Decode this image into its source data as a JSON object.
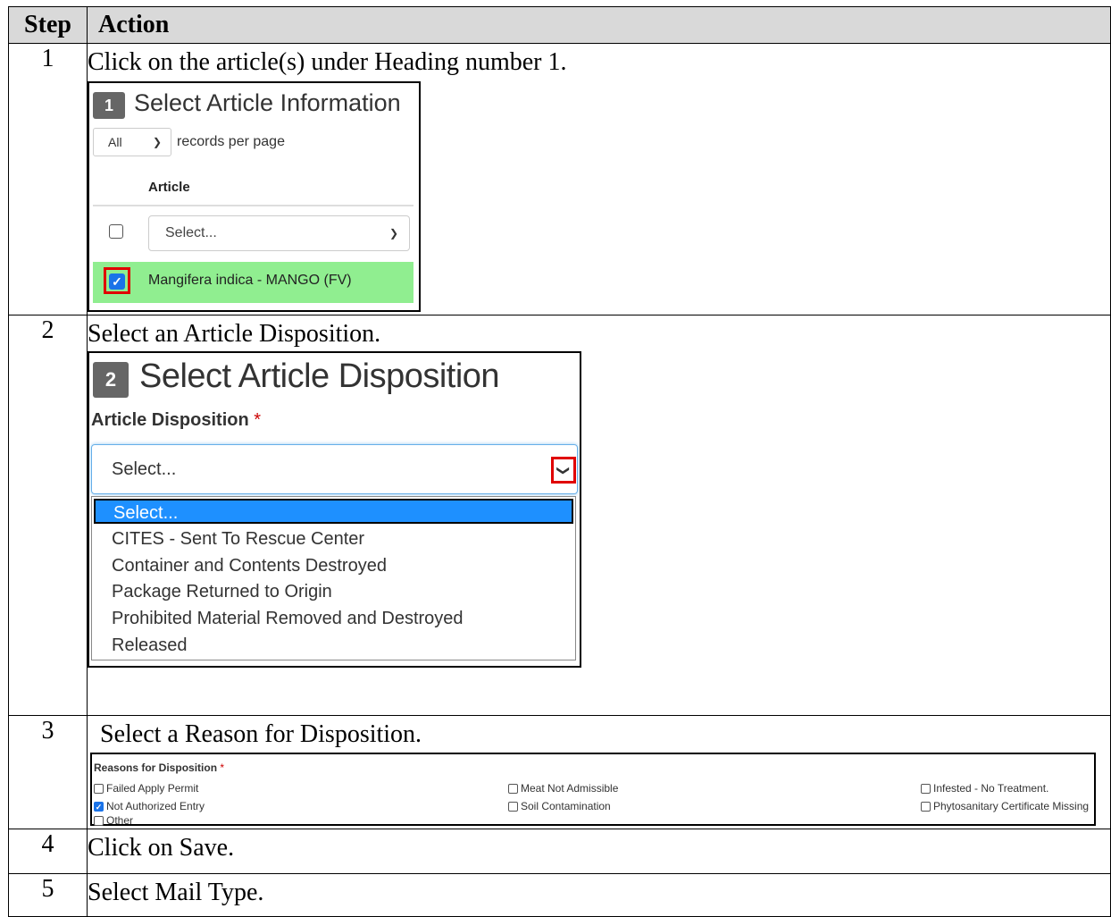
{
  "header": {
    "step": "Step",
    "action": "Action"
  },
  "steps": [
    {
      "num": "1",
      "text": "Click on the article(s) under Heading number 1."
    },
    {
      "num": "2",
      "text": "Select an Article Disposition."
    },
    {
      "num": "3",
      "text": "Select a Reason for Disposition."
    },
    {
      "num": "4",
      "text": "Click on Save."
    },
    {
      "num": "5",
      "text": "Select Mail Type."
    }
  ],
  "panel1": {
    "badge": "1",
    "title": "Select Article Information",
    "records_select_value": "All",
    "records_label": "records per page",
    "column_header": "Article",
    "select_placeholder": "Select...",
    "article_row": {
      "label": "Mangifera indica - MANGO (FV)",
      "checked": true
    }
  },
  "panel2": {
    "badge": "2",
    "title": "Select Article Disposition",
    "field_label": "Article Disposition",
    "required_mark": "*",
    "select_value": "Select...",
    "options": [
      "Select...",
      "CITES - Sent To Rescue Center",
      "Container and Contents Destroyed",
      "Package Returned to Origin",
      "Prohibited Material Removed and Destroyed",
      "Released"
    ],
    "selected_index": 0
  },
  "panel3": {
    "label": "Reasons for Disposition",
    "required_mark": "*",
    "reasons": [
      {
        "label": "Failed Apply Permit",
        "checked": false
      },
      {
        "label": "Not Authorized Entry",
        "checked": true
      },
      {
        "label": "Other",
        "checked": false
      },
      {
        "label": "Meat Not Admissible",
        "checked": false
      },
      {
        "label": "Soil Contamination",
        "checked": false
      },
      {
        "label": "Infested - No Treatment.",
        "checked": false
      },
      {
        "label": "Phytosanitary Certificate Missing",
        "checked": false
      }
    ]
  },
  "colors": {
    "header_bg": "#d9d9d9",
    "highlight_red": "#e00000",
    "row_green": "#90ee90",
    "select_blue": "#1e90ff",
    "badge_gray": "#666666"
  }
}
